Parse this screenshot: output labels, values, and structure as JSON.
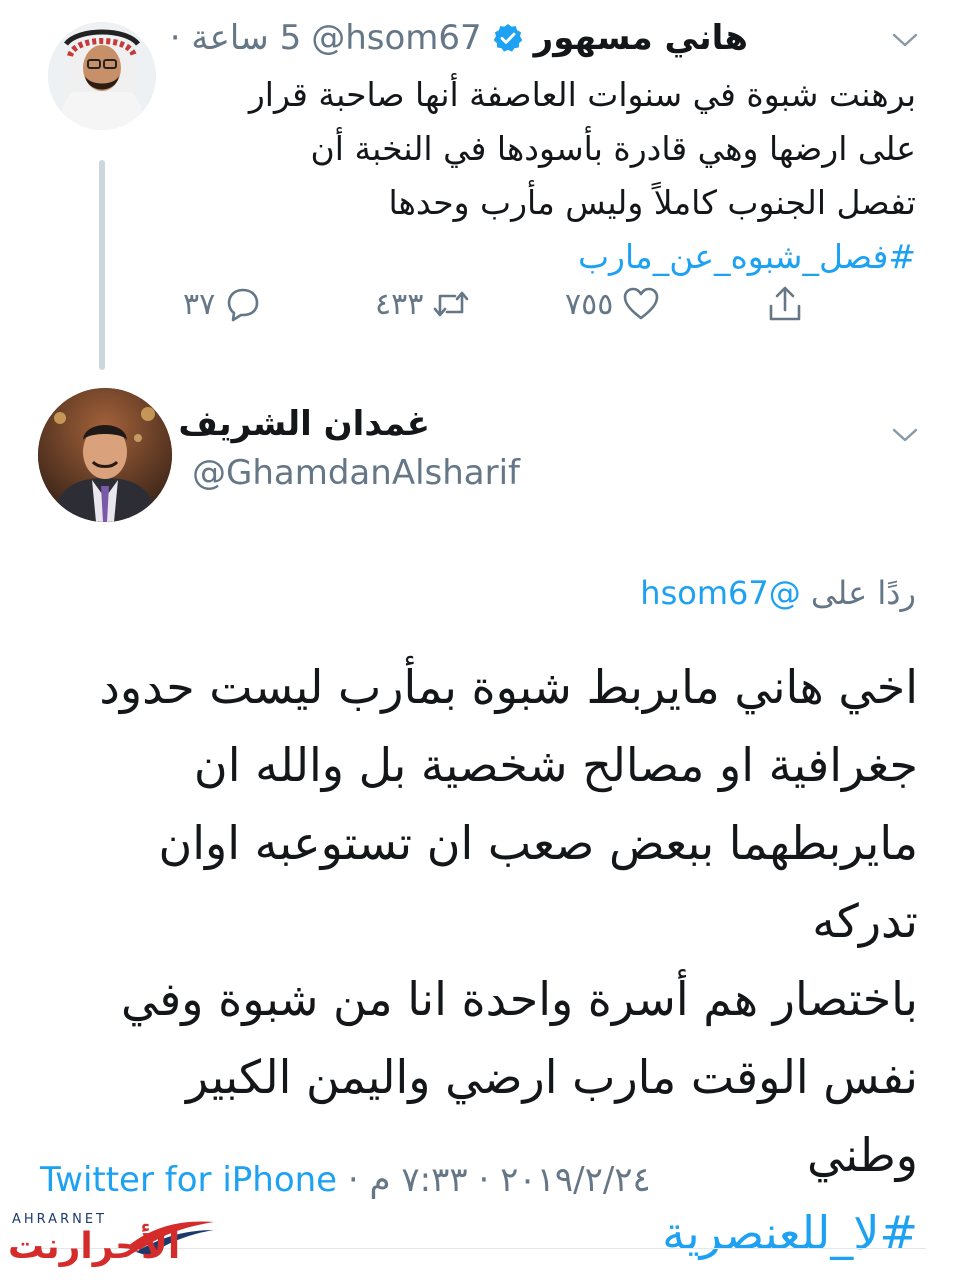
{
  "parent_tweet": {
    "name": "هاني مسهور",
    "handle": "@hsom67",
    "time": "5 ساعة ·",
    "text_lines": [
      "برهنت شبوة في سنوات العاصفة أنها صاحبة قرار",
      "على ارضها وهي قادرة بأسودها في النخبة أن",
      "تفصل الجنوب كاملاً وليس مأرب وحدها"
    ],
    "hashtag": "#فصل_شبوه_عن_مارب",
    "reply_count": "٣٧",
    "retweet_count": "٤٣٣",
    "like_count": "٧٥٥",
    "verified": true
  },
  "main_tweet": {
    "name": "غمدان الشريف",
    "handle": "@GhamdanAlsharif",
    "reply_prefix": "ردًا على",
    "reply_handle": "@hsom67",
    "text_lines": [
      "اخي هاني مايربط شبوة بمأرب ليست حدود",
      "جغرافية او مصالح شخصية بل والله ان",
      "مايربطهما ببعض صعب ان تستوعبه اوان تدركه",
      "باختصار هم أسرة واحدة انا من شبوة وفي",
      "نفس الوقت مارب ارضي واليمن الكبير وطني"
    ],
    "hashtag": "#لا_للعنصرية",
    "time": "٧:٣٣ م",
    "date": "٢٠١٩/٢/٢٤",
    "source": "Twitter for iPhone",
    "separator": " · "
  },
  "watermark": {
    "latin": "AHRARNET",
    "arabic": "الأحرارنت"
  },
  "colors": {
    "link": "#1da1f2",
    "secondary": "#657786",
    "text": "#14171a",
    "watermark_red": "#d42b2b",
    "watermark_blue": "#1a3a6e"
  },
  "icons": [
    "chevron-down-icon",
    "verified-badge-icon",
    "reply-icon",
    "retweet-icon",
    "like-icon",
    "share-icon"
  ]
}
